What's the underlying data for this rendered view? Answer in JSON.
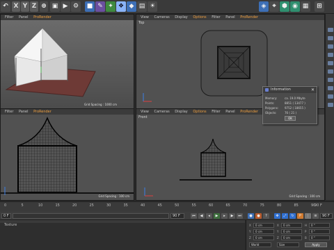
{
  "toolbar": {
    "axis_x": "X",
    "axis_y": "Y",
    "axis_z": "Z"
  },
  "viewports": {
    "perspective": {
      "menu": [
        "Filter",
        "Panel",
        "ProRender"
      ],
      "grid_spacing": "Grid Spacing : 1000 cm"
    },
    "top": {
      "menu": [
        "View",
        "Cameras",
        "Display",
        "Options",
        "Filter",
        "Panel",
        "ProRender"
      ],
      "label": "Top"
    },
    "right": {
      "menu": [
        "Filter",
        "Panel",
        "ProRender"
      ],
      "grid_spacing": "Grid Spacing : 100 cm"
    },
    "front": {
      "menu": [
        "View",
        "Cameras",
        "Display",
        "Options",
        "Filter",
        "Panel",
        "ProRender"
      ],
      "label": "Front",
      "grid_spacing": "Grid Spacing : 100 cm"
    }
  },
  "info_dialog": {
    "title": "Information",
    "rows": [
      {
        "label": "Memory:",
        "value": "ca. 19.0 Mbyte"
      },
      {
        "label": "Points:",
        "value": "8851 ( 13477 )"
      },
      {
        "label": "Polygons:",
        "value": "9752 ( 18655 )"
      },
      {
        "label": "Objects:",
        "value": "76 ( 21 )"
      }
    ],
    "ok_label": "OK"
  },
  "timeline": {
    "ticks": [
      "0",
      "5",
      "10",
      "15",
      "20",
      "25",
      "30",
      "35",
      "40",
      "45",
      "50",
      "55",
      "60",
      "65",
      "70",
      "75",
      "80",
      "85",
      "90"
    ],
    "end_frame": "90 F"
  },
  "transport": {
    "current_frame": "0 F",
    "start_frame": "0 F",
    "end_frame_field": "90 F",
    "end_frame_field2": "90 F"
  },
  "bottom_panel": {
    "label": "Texture"
  },
  "attributes": {
    "rows": [
      {
        "a": "X",
        "av": "0 cm",
        "b": "X",
        "bv": "0 cm",
        "c": "H",
        "cv": "0 °"
      },
      {
        "a": "Y",
        "av": "0 cm",
        "b": "Y",
        "bv": "0 cm",
        "c": "P",
        "cv": "0 °"
      },
      {
        "a": "Z",
        "av": "0 cm",
        "b": "Z",
        "bv": "0 cm",
        "c": "B",
        "cv": "0 °"
      }
    ],
    "world_label": "World",
    "size_label": "Size",
    "apply_label": "Apply"
  }
}
